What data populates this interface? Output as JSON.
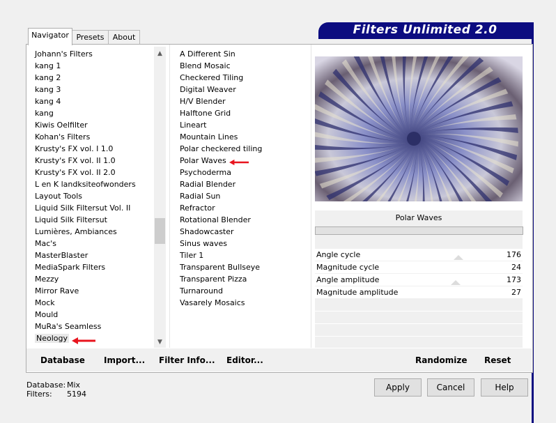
{
  "tabs": [
    {
      "label": "Navigator",
      "active": true
    },
    {
      "label": "Presets",
      "active": false
    },
    {
      "label": "About",
      "active": false
    }
  ],
  "app_title": "Filters Unlimited 2.0",
  "categories": [
    "Johann's Filters",
    "kang 1",
    "kang 2",
    "kang 3",
    "kang 4",
    "kang",
    "Kiwis Oelfilter",
    "Kohan's Filters",
    "Krusty's FX vol. I 1.0",
    "Krusty's FX vol. II 1.0",
    "Krusty's FX vol. II 2.0",
    "L en K landksiteofwonders",
    "Layout Tools",
    "Liquid Silk Filtersut Vol. II",
    "Liquid Silk Filtersut",
    "Lumières, Ambiances",
    "Mac's",
    "MasterBlaster",
    "MediaSpark Filters",
    "Mezzy",
    "Mirror Rave",
    "Mock",
    "Mould",
    "MuRa's Seamless",
    "Neology"
  ],
  "selected_category": "Neology",
  "filters": [
    "A Different Sin",
    "Blend Mosaic",
    "Checkered Tiling",
    "Digital Weaver",
    "H/V Blender",
    "Halftone Grid",
    "Lineart",
    "Mountain Lines",
    "Polar checkered tiling",
    "Polar Waves",
    "Psychoderma",
    "Radial Blender",
    "Radial Sun",
    "Refractor",
    "Rotational Blender",
    "Shadowcaster",
    "Sinus waves",
    "Tiler 1",
    "Transparent Bullseye",
    "Transparent Pizza",
    "Turnaround",
    "Vasarely Mosaics"
  ],
  "selected_filter": "Polar Waves",
  "params_panel": {
    "filter_name": "Polar Waves",
    "params": [
      {
        "label": "Angle cycle",
        "value": "176"
      },
      {
        "label": "Magnitude cycle",
        "value": "24"
      },
      {
        "label": "Angle amplitude",
        "value": "173"
      },
      {
        "label": "Magnitude amplitude",
        "value": "27"
      }
    ]
  },
  "bottom_buttons": {
    "database": "Database",
    "import": "Import...",
    "filter_info": "Filter Info...",
    "editor": "Editor...",
    "randomize": "Randomize",
    "reset": "Reset"
  },
  "status": {
    "database_label": "Database:",
    "database_value": "Mix",
    "filters_label": "Filters:",
    "filters_value": "5194"
  },
  "dialog_buttons": {
    "apply": "Apply",
    "cancel": "Cancel",
    "help": "Help"
  },
  "colors": {
    "banner": "#0c0c80",
    "annotation_arrow": "#e8141e"
  },
  "icons": [
    "scroll-up-arrow-icon",
    "scroll-down-arrow-icon",
    "red-arrow-annotation-icon"
  ]
}
